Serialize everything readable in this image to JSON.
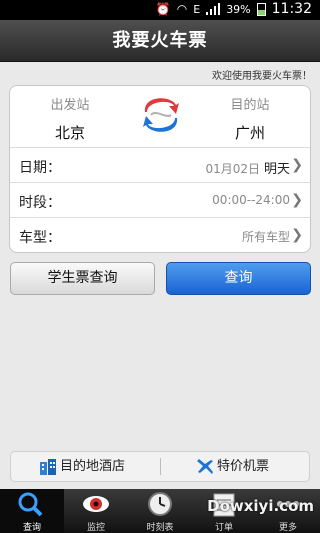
{
  "status_bar": {
    "battery": "39%",
    "time": "11:32",
    "network": "E"
  },
  "header": {
    "title": "我要火车票"
  },
  "welcome": "欢迎使用我要火车票！",
  "route": {
    "from_label": "出发站",
    "from_city": "北京",
    "to_label": "目的站",
    "to_city": "广州"
  },
  "form": {
    "date_label": "日期：",
    "date_value": "01月02日",
    "date_day": "明天",
    "time_label": "时段：",
    "time_value": "00:00--24:00",
    "type_label": "车型：",
    "type_value": "所有车型"
  },
  "buttons": {
    "student": "学生票查询",
    "query": "查询"
  },
  "links": {
    "hotel": "目的地酒店",
    "flight": "特价机票"
  },
  "tabs": [
    {
      "label": "查询",
      "icon": "search-icon"
    },
    {
      "label": "监控",
      "icon": "eye-icon"
    },
    {
      "label": "时刻表",
      "icon": "clock-icon"
    },
    {
      "label": "订单",
      "icon": "ticket-icon"
    },
    {
      "label": "更多",
      "icon": "more-icon"
    }
  ],
  "watermark": "Dowxiyi.com",
  "colors": {
    "accent": "#1a63d3",
    "swap_red": "#e03a3a",
    "swap_blue": "#1c74d8"
  }
}
